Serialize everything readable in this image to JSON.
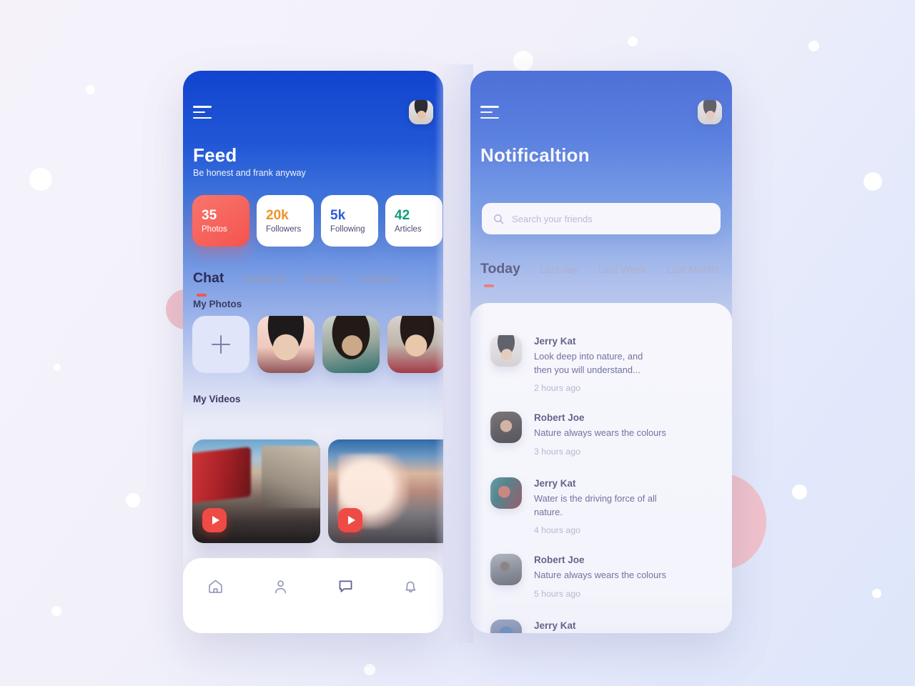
{
  "background": {
    "base_color": "#f3f1f9",
    "accent_pink": "#f0c2cc"
  },
  "colors": {
    "brand_blue": "#1144cf",
    "accent_red": "#f4544f",
    "orange": "#f0932b",
    "blue": "#2e5bd8",
    "green": "#0d9e79",
    "dark_text": "#2d2d5e",
    "muted_text": "#a3a5c4"
  },
  "feed_screen": {
    "menu_icon": "hamburger-menu-icon",
    "avatar": "user-avatar",
    "title": "Feed",
    "subtitle": "Be honest and frank anyway",
    "stats": [
      {
        "value": "35",
        "label": "Photos",
        "active": true,
        "color": "#ffffff"
      },
      {
        "value": "20k",
        "label": "Followers",
        "active": false,
        "color": "#f0932b"
      },
      {
        "value": "5k",
        "label": "Following",
        "active": false,
        "color": "#2e5bd8"
      },
      {
        "value": "42",
        "label": "Articles",
        "active": false,
        "color": "#0d9e79"
      }
    ],
    "tabs": [
      {
        "label": "Chat",
        "active": true
      },
      {
        "label": "Featured",
        "active": false
      },
      {
        "label": "Popular",
        "active": false
      },
      {
        "label": "Follower",
        "active": false
      }
    ],
    "photos_section_label": "My Photos",
    "photos": [
      {
        "name": "add-photo",
        "kind": "add"
      },
      {
        "name": "photo-1",
        "kind": "image",
        "art": "face-g"
      },
      {
        "name": "photo-2",
        "kind": "image",
        "art": "face-h"
      },
      {
        "name": "photo-3",
        "kind": "image",
        "art": "face-i"
      }
    ],
    "videos_section_label": "My Videos",
    "videos": [
      {
        "name": "video-street",
        "play_icon": "play-icon"
      },
      {
        "name": "video-wave",
        "play_icon": "play-icon"
      }
    ],
    "bottom_nav": [
      {
        "name": "home-icon",
        "active": false
      },
      {
        "name": "profile-icon",
        "active": false
      },
      {
        "name": "chat-icon",
        "active": true
      },
      {
        "name": "notification-icon",
        "active": false
      }
    ]
  },
  "notification_screen": {
    "menu_icon": "hamburger-menu-icon",
    "avatar": "user-avatar",
    "title": "Notificaltion",
    "search": {
      "icon": "search-icon",
      "placeholder": "Search your friends",
      "value": ""
    },
    "tabs": [
      {
        "label": "Today",
        "active": true
      },
      {
        "label": "Last day",
        "active": false
      },
      {
        "label": "Last Week",
        "active": false
      },
      {
        "label": "Last Month",
        "active": false
      }
    ],
    "items": [
      {
        "name": "Jerry Kat",
        "message": "Look deep into nature, and then you will understand...",
        "time": "2 hours ago",
        "art": "face-a"
      },
      {
        "name": "Robert Joe",
        "message": "Nature always wears the colours",
        "time": "3 hours ago",
        "art": "face-c"
      },
      {
        "name": "Jerry Kat",
        "message": "Water is the driving force of all nature.",
        "time": "4 hours ago",
        "art": "face-d"
      },
      {
        "name": "Robert Joe",
        "message": "Nature always wears the colours",
        "time": "5 hours ago",
        "art": "face-e"
      },
      {
        "name": "Jerry Kat",
        "message": "",
        "time": "",
        "art": "face-f"
      }
    ]
  }
}
